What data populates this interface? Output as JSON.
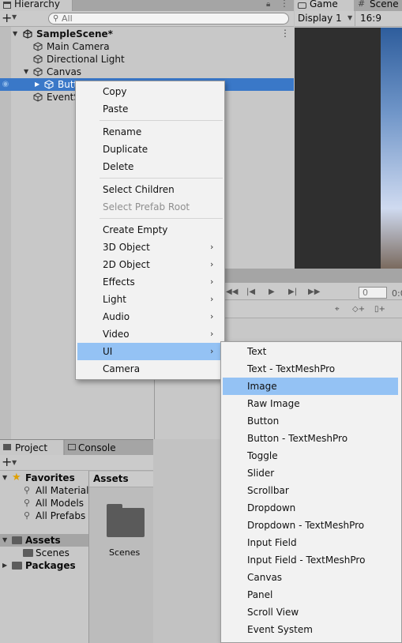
{
  "hierarchy": {
    "tab_label": "Hierarchy",
    "search_placeholder": "All",
    "rows": [
      {
        "label": "SampleScene*"
      },
      {
        "label": "Main Camera"
      },
      {
        "label": "Directional Light"
      },
      {
        "label": "Canvas"
      },
      {
        "label": "Butt"
      },
      {
        "label": "EventS"
      }
    ]
  },
  "game_view": {
    "tabs": [
      {
        "label": "Game"
      },
      {
        "label": "Scene"
      }
    ],
    "display_label": "Display 1",
    "aspect_label": "16:9"
  },
  "timeline": {
    "frame_value": "0",
    "frame_value_2": "0:0"
  },
  "project": {
    "tabs": [
      {
        "label": "Project"
      },
      {
        "label": "Console"
      }
    ],
    "assets_header": "Assets",
    "favorites": {
      "label": "Favorites",
      "items": [
        "All Materials",
        "All Models",
        "All Prefabs"
      ]
    },
    "assets_label": "Assets",
    "scenes_label": "Scenes",
    "packages_label": "Packages",
    "grid_items": [
      {
        "label": "Scenes"
      }
    ]
  },
  "context_menu": {
    "items": [
      "Copy",
      "Paste",
      "Rename",
      "Duplicate",
      "Delete",
      "Select Children",
      "Select Prefab Root",
      "Create Empty",
      "3D Object",
      "2D Object",
      "Effects",
      "Light",
      "Audio",
      "Video",
      "UI",
      "Camera"
    ],
    "disabled": [
      "Select Prefab Root"
    ],
    "highlighted": "UI"
  },
  "ui_submenu": {
    "items": [
      "Text",
      "Text - TextMeshPro",
      "Image",
      "Raw Image",
      "Button",
      "Button - TextMeshPro",
      "Toggle",
      "Slider",
      "Scrollbar",
      "Dropdown",
      "Dropdown - TextMeshPro",
      "Input Field",
      "Input Field - TextMeshPro",
      "Canvas",
      "Panel",
      "Scroll View",
      "Event System"
    ],
    "highlighted": "Image"
  },
  "colors": {
    "selection_blue": "#3a78c8",
    "menu_highlight": "#94c2f4",
    "panel_gray": "#c8c8c8"
  }
}
